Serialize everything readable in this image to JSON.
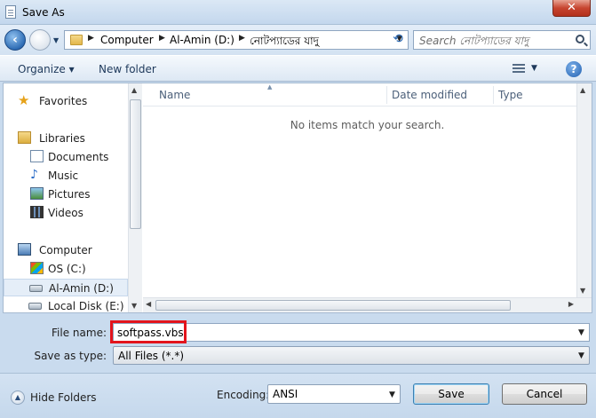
{
  "window": {
    "title": "Save As",
    "close_label": "✕"
  },
  "address": {
    "crumbs": [
      "Computer",
      "Al-Amin (D:)",
      "নোটপ্যাডের যাদু"
    ],
    "search_placeholder": "Search নোটপ্যাডের যাদু"
  },
  "toolbar": {
    "organize": "Organize ▾",
    "new_folder": "New folder"
  },
  "nav": {
    "items": [
      {
        "label": "Favorites",
        "icon": "star-icon"
      },
      {
        "label": "Libraries",
        "icon": "library-icon"
      },
      {
        "label": "Documents",
        "icon": "documents-icon"
      },
      {
        "label": "Music",
        "icon": "music-icon"
      },
      {
        "label": "Pictures",
        "icon": "pictures-icon"
      },
      {
        "label": "Videos",
        "icon": "videos-icon"
      },
      {
        "label": "Computer",
        "icon": "computer-icon"
      },
      {
        "label": "OS (C:)",
        "icon": "os-drive-icon"
      },
      {
        "label": "Al-Amin (D:)",
        "icon": "drive-icon",
        "selected": true
      },
      {
        "label": "Local Disk (E:)",
        "icon": "drive-icon"
      }
    ]
  },
  "files": {
    "columns": [
      "Name",
      "Date modified",
      "Type"
    ],
    "empty_message": "No items match your search."
  },
  "form": {
    "file_name_label": "File name:",
    "file_name_value": "softpass.vbs",
    "save_type_label": "Save as type:",
    "save_type_value": "All Files  (*.*)"
  },
  "footer": {
    "hide_folders": "Hide Folders",
    "encoding_label": "Encoding:",
    "encoding_value": "ANSI",
    "save": "Save",
    "cancel": "Cancel"
  },
  "colors": {
    "highlight": "#e3141c",
    "accent": "#2f6db5"
  }
}
